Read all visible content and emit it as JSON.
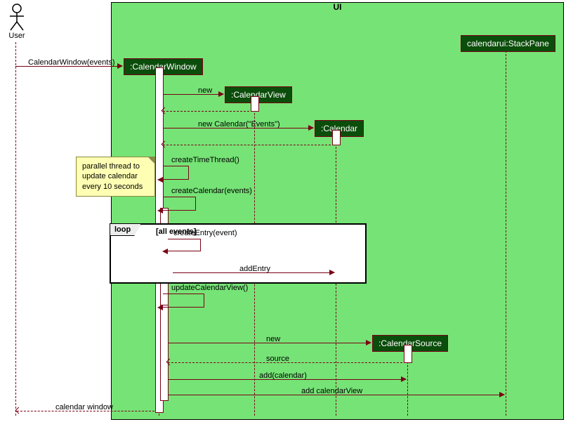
{
  "frame": {
    "title": "UI"
  },
  "actor": {
    "label": "User"
  },
  "participants": {
    "cw": {
      "label": ":CalendarWindow"
    },
    "cv": {
      "label": ":CalendarView"
    },
    "cal": {
      "label": ":Calendar"
    },
    "cs": {
      "label": ":CalendarSource"
    },
    "sp": {
      "label": "calendarui:StackPane"
    }
  },
  "note_thread": "parallel thread to update calendar every 10 seconds",
  "loop": {
    "name": "loop",
    "cond": "[all events]"
  },
  "msgs": {
    "m1": "CalendarWindow(events)",
    "m2": "new",
    "m3": "new Calendar(\"Events\")",
    "m4": "createTimeThread()",
    "m5": "createCalendar(events)",
    "m6": "createEntry(event)",
    "m7": "addEntry",
    "m8": "updateCalendarView()",
    "m9": "new",
    "m10": "source",
    "m11": "add(calendar)",
    "m12": "add calendarView",
    "m13": "calendar window"
  },
  "chart_data": {
    "type": "table",
    "diagram": "UML sequence diagram",
    "frame": "UI",
    "actors": [
      "User"
    ],
    "participants": [
      ":CalendarWindow",
      ":CalendarView",
      ":Calendar",
      ":CalendarSource",
      "calendarui:StackPane"
    ],
    "messages": [
      {
        "from": "User",
        "to": ":CalendarWindow",
        "label": "CalendarWindow(events)",
        "type": "sync"
      },
      {
        "from": ":CalendarWindow",
        "to": ":CalendarView",
        "label": "new",
        "type": "create"
      },
      {
        "from": ":CalendarView",
        "to": ":CalendarWindow",
        "label": "",
        "type": "return"
      },
      {
        "from": ":CalendarWindow",
        "to": ":Calendar",
        "label": "new Calendar(\"Events\")",
        "type": "create"
      },
      {
        "from": ":Calendar",
        "to": ":CalendarWindow",
        "label": "",
        "type": "return"
      },
      {
        "from": ":CalendarWindow",
        "to": ":CalendarWindow",
        "label": "createTimeThread()",
        "type": "self",
        "note": "parallel thread to update calendar every 10 seconds"
      },
      {
        "from": ":CalendarWindow",
        "to": ":CalendarWindow",
        "label": "createCalendar(events)",
        "type": "self"
      },
      {
        "fragment": "loop",
        "guard": "[all events]",
        "contains": [
          {
            "from": ":CalendarWindow",
            "to": ":CalendarWindow",
            "label": "createEntry(event)",
            "type": "self"
          },
          {
            "from": ":CalendarWindow",
            "to": ":Calendar",
            "label": "addEntry",
            "type": "sync"
          }
        ]
      },
      {
        "from": ":CalendarWindow",
        "to": ":CalendarWindow",
        "label": "updateCalendarView()",
        "type": "self"
      },
      {
        "from": ":CalendarWindow",
        "to": ":CalendarSource",
        "label": "new",
        "type": "create"
      },
      {
        "from": ":CalendarSource",
        "to": ":CalendarWindow",
        "label": "source",
        "type": "return"
      },
      {
        "from": ":CalendarWindow",
        "to": ":CalendarSource",
        "label": "add(calendar)",
        "type": "sync"
      },
      {
        "from": ":CalendarWindow",
        "to": "calendarui:StackPane",
        "label": "add calendarView",
        "type": "sync"
      },
      {
        "from": ":CalendarWindow",
        "to": "User",
        "label": "calendar window",
        "type": "return"
      }
    ]
  }
}
